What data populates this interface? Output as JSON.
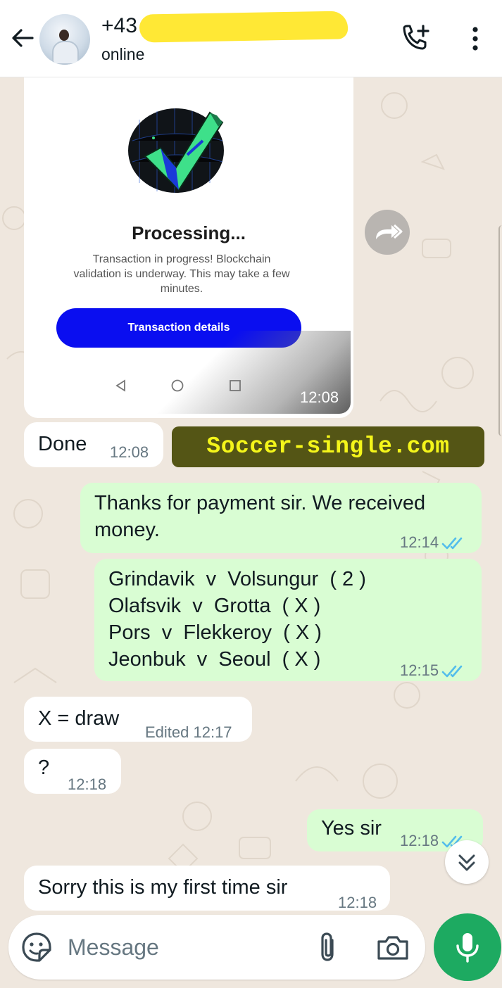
{
  "header": {
    "contact_number": "+43",
    "status": "online"
  },
  "image_message": {
    "title": "Processing...",
    "description": "Transaction in progress! Blockchain validation is underway. This may take a few minutes.",
    "button_label": "Transaction details",
    "time": "12:08"
  },
  "watermark": "Soccer-single.com",
  "messages": [
    {
      "direction": "incoming",
      "text": "Done",
      "time": "12:08"
    },
    {
      "direction": "outgoing",
      "lines": [
        "Thanks for payment sir. We received",
        "money."
      ],
      "time": "12:14",
      "status": "read"
    },
    {
      "direction": "outgoing",
      "lines": [
        "Grindavik  v  Volsungur  ( 2 )",
        "Olafsvik  v  Grotta  ( X )",
        "Pors  v  Flekkeroy  ( X )",
        "Jeonbuk  v  Seoul  ( X )"
      ],
      "time": "12:15",
      "status": "read"
    },
    {
      "direction": "incoming",
      "text": "X = draw",
      "time": "Edited 12:17"
    },
    {
      "direction": "incoming",
      "text": "?",
      "time": "12:18"
    },
    {
      "direction": "outgoing",
      "text": "Yes sir",
      "time": "12:18",
      "status": "read"
    },
    {
      "direction": "incoming",
      "text": "Sorry this is my first time sir",
      "time": "12:18"
    }
  ],
  "composer": {
    "placeholder": "Message"
  },
  "colors": {
    "outgoing_bubble": "#d9fdd3",
    "incoming_bubble": "#ffffff",
    "chat_background": "#efe7de",
    "read_ticks": "#53bdeb",
    "mic_button": "#1daa61",
    "tx_button": "#0a0ef0",
    "watermark_bg": "#545515",
    "watermark_text": "#f4f51a"
  },
  "icons": [
    "back-arrow-icon",
    "add-call-icon",
    "more-vertical-icon",
    "forward-icon",
    "double-check-icon",
    "chevrons-down-icon",
    "sticker-icon",
    "paperclip-icon",
    "camera-icon",
    "mic-icon"
  ]
}
